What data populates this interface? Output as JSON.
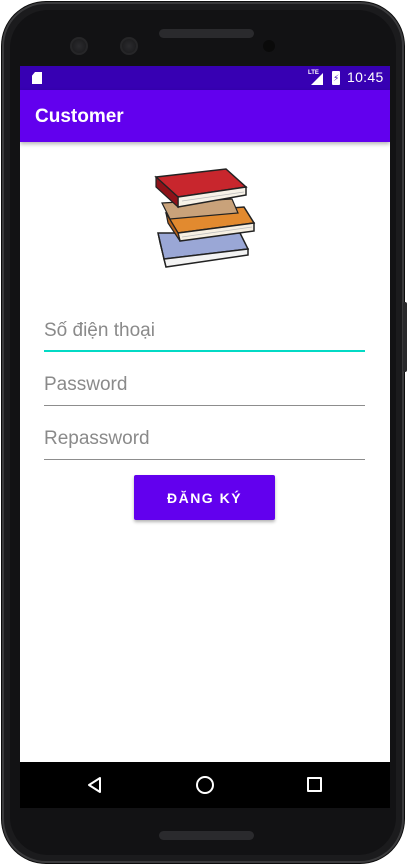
{
  "status_bar": {
    "network_label": "LTE",
    "time": "10:45",
    "icons": [
      "sd-card-icon",
      "signal-icon",
      "battery-charging-icon"
    ]
  },
  "app_bar": {
    "title": "Customer"
  },
  "header_image": {
    "icon": "books-stack-image"
  },
  "form": {
    "phone_placeholder": "Số điện thoại",
    "phone_value": "",
    "password_placeholder": "Password",
    "password_value": "",
    "repassword_placeholder": "Repassword",
    "repassword_value": "",
    "register_label": "ĐĂNG KÝ"
  },
  "nav_bar": {
    "icons": [
      "back-icon",
      "home-icon",
      "recents-icon"
    ]
  },
  "colors": {
    "primary": "#6200ee",
    "primary_dark": "#3700b3",
    "accent": "#03dac5"
  }
}
